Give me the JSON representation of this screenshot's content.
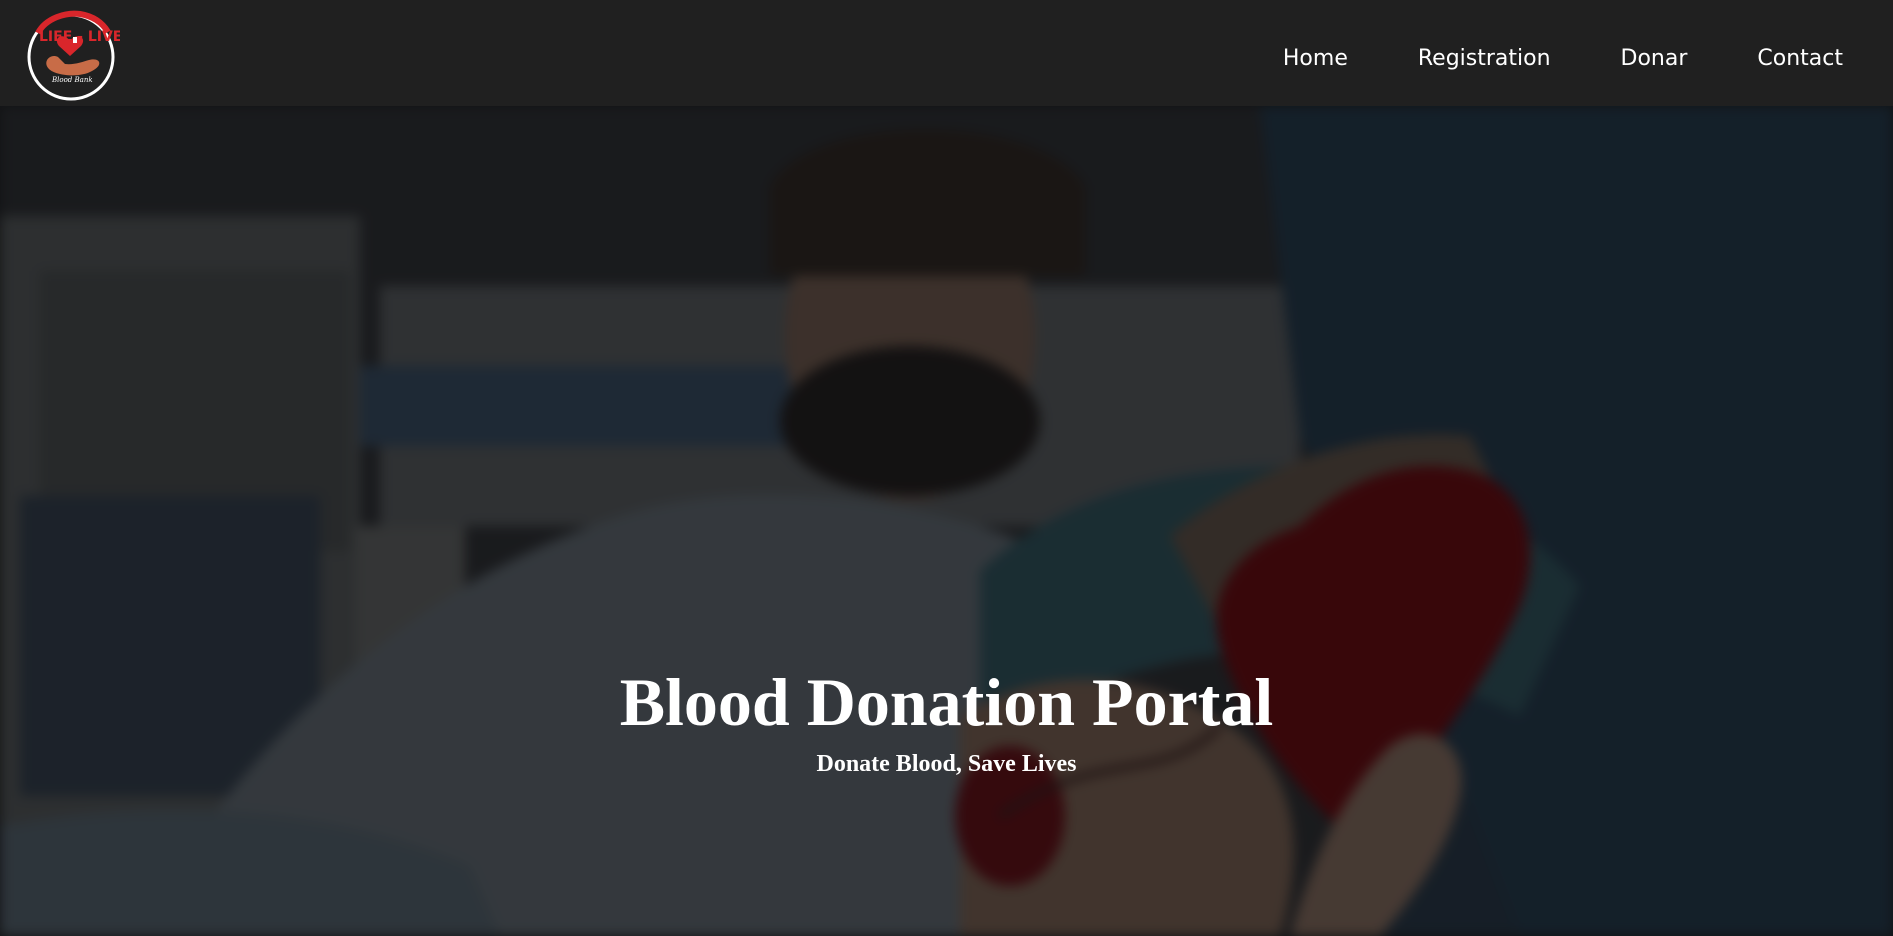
{
  "brand": {
    "logo_text_top": "LIFE - LIVE",
    "logo_text_bottom": "Blood Bank",
    "colors": {
      "red": "#d9262b",
      "hand": "#c86c47",
      "ring": "#ffffff"
    }
  },
  "nav": {
    "items": [
      {
        "label": "Home"
      },
      {
        "label": "Registration"
      },
      {
        "label": "Donar"
      },
      {
        "label": "Contact"
      }
    ]
  },
  "hero": {
    "title": "Blood Donation Portal",
    "subtitle": "Donate Blood, Save Lives",
    "image_icon": "blood-donation-photo"
  }
}
